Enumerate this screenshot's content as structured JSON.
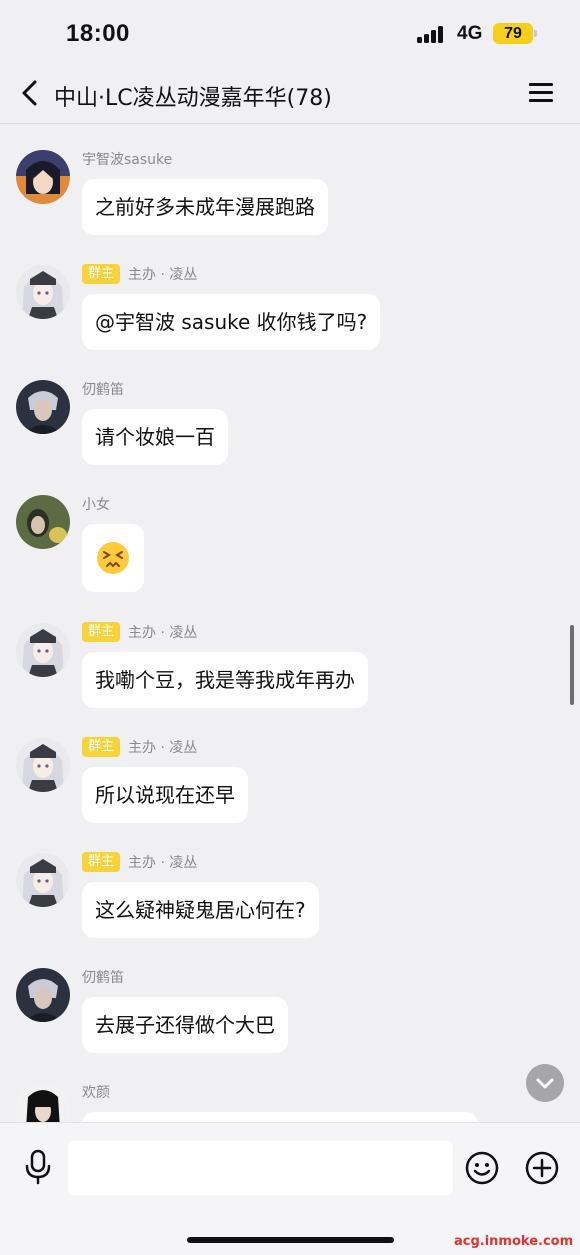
{
  "status_bar": {
    "time": "18:00",
    "network": "4G",
    "battery": "79"
  },
  "nav": {
    "title": "中山·LC凌丛动漫嘉年华(78)",
    "back_icon": "chevron-left-icon",
    "menu_icon": "hamburger-menu-icon"
  },
  "messages": [
    {
      "sender": "宇智波sasuke",
      "badge": "",
      "text": "之前好多未成年漫展跑路",
      "avatar_colors": [
        "#3a3f6e",
        "#e08a3c",
        "#1a1a2a"
      ]
    },
    {
      "sender": "主办 · 凌丛",
      "badge": "群主",
      "text": "@宇智波 sasuke 收你钱了吗?",
      "avatar_colors": [
        "#e9e9ee",
        "#3b3b44",
        "#9aa0b5"
      ]
    },
    {
      "sender": "仞鹤笛",
      "badge": "",
      "text": "请个妆娘一百",
      "avatar_colors": [
        "#2c3140",
        "#c9ccd6",
        "#1b1d24"
      ]
    },
    {
      "sender": "小女",
      "badge": "",
      "text": "",
      "emoji": "confounded-face",
      "avatar_colors": [
        "#5d6b45",
        "#d8c35a",
        "#2b2f24"
      ]
    },
    {
      "sender": "主办 · 凌丛",
      "badge": "群主",
      "text": "我嘞个豆，我是等我成年再办",
      "avatar_colors": [
        "#e9e9ee",
        "#3b3b44",
        "#9aa0b5"
      ]
    },
    {
      "sender": "主办 · 凌丛",
      "badge": "群主",
      "text": "所以说现在还早",
      "avatar_colors": [
        "#e9e9ee",
        "#3b3b44",
        "#9aa0b5"
      ]
    },
    {
      "sender": "主办 · 凌丛",
      "badge": "群主",
      "text": "这么疑神疑鬼居心何在?",
      "avatar_colors": [
        "#e9e9ee",
        "#3b3b44",
        "#9aa0b5"
      ]
    },
    {
      "sender": "仞鹤笛",
      "badge": "",
      "text": "去展子还得做个大巴",
      "avatar_colors": [
        "#2c3140",
        "#c9ccd6",
        "#1b1d24"
      ]
    },
    {
      "sender": "欢颜",
      "badge": "",
      "text": "",
      "avatar_colors": [
        "#f2f2f2",
        "#111111",
        "#444444"
      ]
    }
  ],
  "input_bar": {
    "placeholder": "",
    "mic_icon": "microphone-icon",
    "emoji_icon": "smiley-icon",
    "plus_icon": "plus-circle-icon"
  },
  "watermark": "acg.inmoke.com",
  "colors": {
    "background": "#f0f0f2",
    "bubble": "#ffffff",
    "owner_badge": "#f7d33a",
    "battery": "#f6cf1d",
    "watermark": "#e03232"
  }
}
